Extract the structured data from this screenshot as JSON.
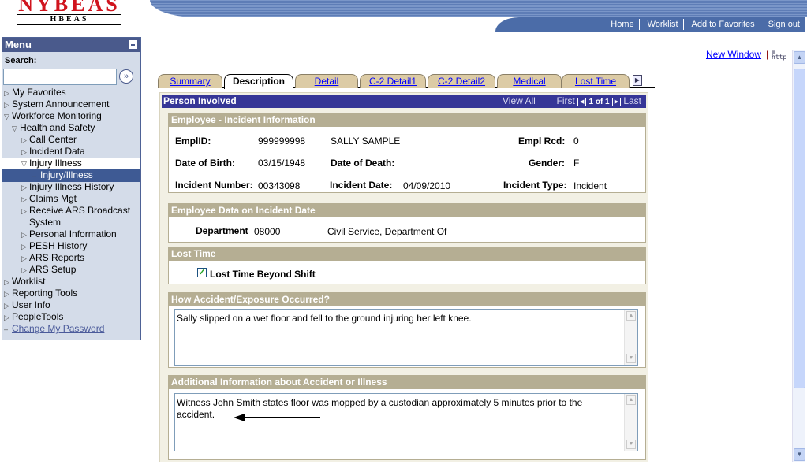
{
  "logo": {
    "title": "NYBEAS",
    "subtitle": "HBEAS"
  },
  "topnav": [
    "Home",
    "Worklist",
    "Add to Favorites",
    "Sign out"
  ],
  "menu": {
    "title": "Menu",
    "search_label": "Search:",
    "search_value": "",
    "items": [
      {
        "label": "My Favorites",
        "level": 0,
        "state": "closed"
      },
      {
        "label": "System Announcement",
        "level": 0,
        "state": "closed"
      },
      {
        "label": "Workforce Monitoring",
        "level": 0,
        "state": "open"
      },
      {
        "label": "Health and Safety",
        "level": 1,
        "state": "open"
      },
      {
        "label": "Call Center",
        "level": 2,
        "state": "closed"
      },
      {
        "label": "Incident Data",
        "level": 2,
        "state": "closed"
      },
      {
        "label": "Injury Illness",
        "level": 2,
        "state": "open"
      },
      {
        "label": "Injury/Illness",
        "level": 3,
        "state": "current"
      },
      {
        "label": "Injury Illness History",
        "level": 2,
        "state": "closed"
      },
      {
        "label": "Claims Mgt",
        "level": 2,
        "state": "closed"
      },
      {
        "label": "Receive ARS Broadcast",
        "level": 2,
        "state": "closed"
      },
      {
        "label": "System",
        "level": 2,
        "state": "cont"
      },
      {
        "label": "Personal Information",
        "level": 2,
        "state": "closed"
      },
      {
        "label": "PESH History",
        "level": 2,
        "state": "closed"
      },
      {
        "label": "ARS Reports",
        "level": 2,
        "state": "closed"
      },
      {
        "label": "ARS Setup",
        "level": 2,
        "state": "closed"
      },
      {
        "label": "Worklist",
        "level": 0,
        "state": "closed"
      },
      {
        "label": "Reporting Tools",
        "level": 0,
        "state": "closed"
      },
      {
        "label": "User Info",
        "level": 0,
        "state": "closed"
      },
      {
        "label": "PeopleTools",
        "level": 0,
        "state": "closed"
      },
      {
        "label": "Change My Password",
        "level": 0,
        "state": "link"
      }
    ]
  },
  "new_window": "New Window",
  "separator": "|",
  "tabs": [
    {
      "label": "Summary",
      "active": false
    },
    {
      "label": "Description",
      "active": true
    },
    {
      "label": "Detail",
      "active": false
    },
    {
      "label": "C-2 Detail1",
      "active": false
    },
    {
      "label": "C-2 Detail2",
      "active": false
    },
    {
      "label": "Medical",
      "active": false
    },
    {
      "label": "Lost Time",
      "active": false
    }
  ],
  "person": {
    "title": "Person Involved",
    "view_all": "View All",
    "first": "First",
    "count": "1 of 1",
    "last": "Last"
  },
  "incident": {
    "title": "Employee - Incident Information",
    "emplid_label": "EmplID:",
    "emplid": "999999998",
    "name": "SALLY SAMPLE",
    "emplrcd_label": "Empl Rcd:",
    "emplrcd": "0",
    "dob_label": "Date of Birth:",
    "dob": "03/15/1948",
    "dod_label": "Date of Death:",
    "dod": "",
    "gender_label": "Gender:",
    "gender": "F",
    "incnum_label": "Incident Number:",
    "incnum": "00343098",
    "incdate_label": "Incident Date:",
    "incdate": "04/09/2010",
    "inctype_label": "Incident Type:",
    "inctype": "Incident"
  },
  "empdata": {
    "title": "Employee Data on Incident Date",
    "dept_label": "Department",
    "dept_code": "08000",
    "dept_name": "Civil Service, Department Of"
  },
  "lost": {
    "title": "Lost Time",
    "checkbox_label": "Lost Time Beyond Shift",
    "checked": true
  },
  "how": {
    "title": "How Accident/Exposure Occurred?",
    "text": "Sally slipped on a wet floor and fell to the ground injuring her left knee."
  },
  "addl": {
    "title": "Additional Information about Accident or Illness",
    "text": "Witness John Smith states floor was mopped by a custodian approximately 5 minutes prior to the accident."
  }
}
